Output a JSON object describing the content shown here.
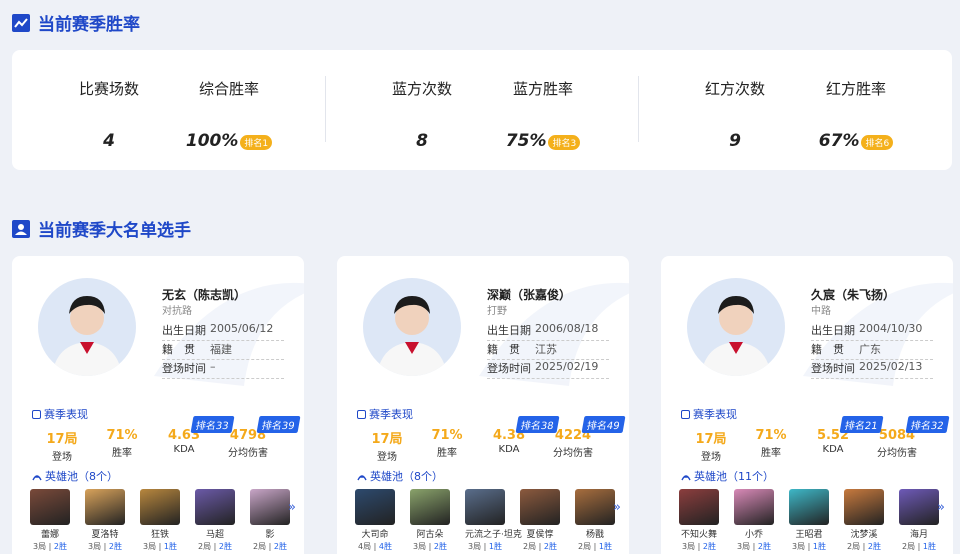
{
  "section1": {
    "title": "当前赛季胜率"
  },
  "stats": [
    {
      "label": "比赛场数",
      "value": "4",
      "rank": ""
    },
    {
      "label": "综合胜率",
      "value": "100%",
      "rank": "排名1"
    },
    {
      "label": "蓝方次数",
      "value": "8",
      "rank": ""
    },
    {
      "label": "蓝方胜率",
      "value": "75%",
      "rank": "排名3"
    },
    {
      "label": "红方次数",
      "value": "9",
      "rank": ""
    },
    {
      "label": "红方胜率",
      "value": "67%",
      "rank": "排名6"
    }
  ],
  "section2": {
    "title": "当前赛季大名单选手"
  },
  "labels": {
    "birth": "出生日期",
    "origin": "籍　贯",
    "debut": "登场时间",
    "season_perf": "赛季表现",
    "appear": "登场",
    "winrate": "胜率",
    "kda": "KDA",
    "dmg": "分均伤害"
  },
  "players": [
    {
      "name": "无玄（陈志凯）",
      "role": "对抗路",
      "birth": "2005/06/12",
      "origin": "福建",
      "debut": "–",
      "appear": "17局",
      "winrate": "71%",
      "kda": "4.63",
      "dmg": "4798",
      "kda_rank": "排名33",
      "dmg_rank": "排名39",
      "hero_pool": "英雄池（8个）",
      "heroes": [
        {
          "name": "蕾娜",
          "games": "3局",
          "wins": "2胜",
          "color": "#7a4a3a"
        },
        {
          "name": "夏洛特",
          "games": "3局",
          "wins": "2胜",
          "color": "#d9a35b"
        },
        {
          "name": "狂铁",
          "games": "3局",
          "wins": "1胜",
          "color": "#b8873e"
        },
        {
          "name": "马超",
          "games": "2局",
          "wins": "2胜",
          "color": "#6b5aa8"
        },
        {
          "name": "影",
          "games": "2局",
          "wins": "2胜",
          "color": "#c9a6c8"
        }
      ]
    },
    {
      "name": "深巅（张嘉俊）",
      "role": "打野",
      "birth": "2006/08/18",
      "origin": "江苏",
      "debut": "2025/02/19",
      "appear": "17局",
      "winrate": "71%",
      "kda": "4.38",
      "dmg": "4224",
      "kda_rank": "排名38",
      "dmg_rank": "排名49",
      "hero_pool": "英雄池（8个）",
      "heroes": [
        {
          "name": "大司命",
          "games": "4局",
          "wins": "4胜",
          "color": "#2d4a6e"
        },
        {
          "name": "阿古朵",
          "games": "3局",
          "wins": "2胜",
          "color": "#8aa36b"
        },
        {
          "name": "元流之子·坦克",
          "games": "3局",
          "wins": "1胜",
          "color": "#5a6e8c"
        },
        {
          "name": "夏侯惇",
          "games": "2局",
          "wins": "2胜",
          "color": "#8c5a3e"
        },
        {
          "name": "杨戬",
          "games": "2局",
          "wins": "1胜",
          "color": "#a86e3e"
        }
      ]
    },
    {
      "name": "久宸（朱飞扬）",
      "role": "中路",
      "birth": "2004/10/30",
      "origin": "广东",
      "debut": "2025/02/13",
      "appear": "17局",
      "winrate": "71%",
      "kda": "5.52",
      "dmg": "5084",
      "kda_rank": "排名21",
      "dmg_rank": "排名32",
      "hero_pool": "英雄池（11个）",
      "heroes": [
        {
          "name": "不知火舞",
          "games": "3局",
          "wins": "2胜",
          "color": "#8c3e3e"
        },
        {
          "name": "小乔",
          "games": "3局",
          "wins": "2胜",
          "color": "#d98ab8"
        },
        {
          "name": "王昭君",
          "games": "3局",
          "wins": "1胜",
          "color": "#3eb8c8"
        },
        {
          "name": "沈梦溪",
          "games": "2局",
          "wins": "2胜",
          "color": "#c87a3e"
        },
        {
          "name": "海月",
          "games": "2局",
          "wins": "1胜",
          "color": "#6e5ab8"
        }
      ]
    }
  ],
  "colors": {
    "accent": "#1f48c8",
    "gold": "#f4a91b",
    "rank_blue": "#2463e8"
  }
}
